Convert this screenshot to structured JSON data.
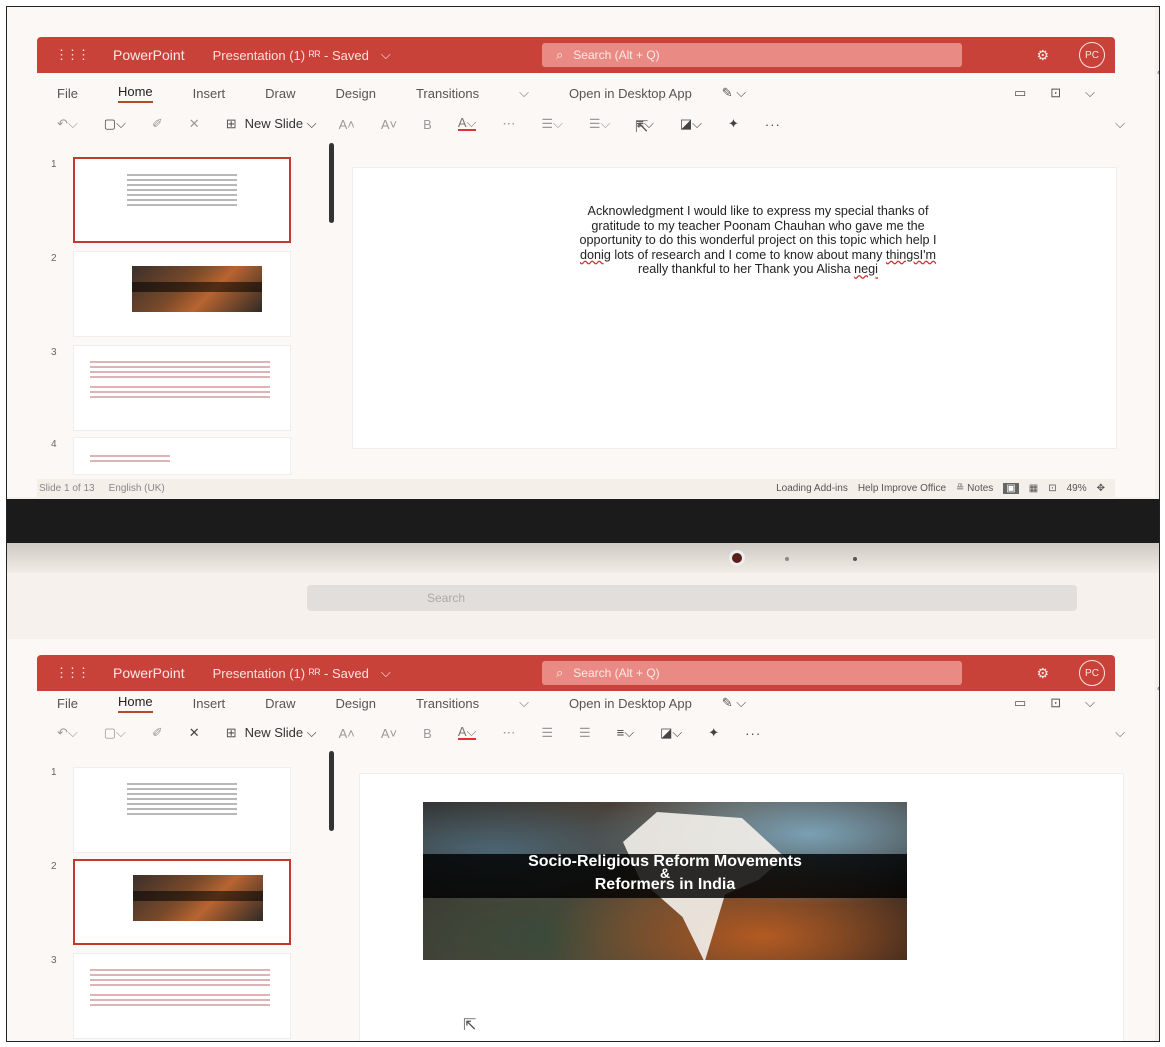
{
  "app": {
    "name": "PowerPoint",
    "doc_title": "Presentation (1) ᴿᴿ - Saved",
    "search_placeholder": "Search (Alt + Q)",
    "user_initials": "PC"
  },
  "tabs": [
    "File",
    "Home",
    "Insert",
    "Draw",
    "Design",
    "Transitions",
    "⌵",
    "Open in Desktop App",
    "✎ ⌵"
  ],
  "toolbar": {
    "new_slide": "New Slide ⌵",
    "more": "···"
  },
  "slides": {
    "numbers": [
      "1",
      "2",
      "3",
      "4"
    ],
    "acknowledgment_parts": {
      "a": "Acknowledgment I would like to express my special thanks of gratitude to my teacher Poonam Chauhan who gave me the opportunity to do this wonderful project on this topic which help I ",
      "b": "donig",
      "c": " lots of research and I come to know about many ",
      "d": "thingsI'm",
      "e": " really thankful to her Thank you Alisha ",
      "f": "negi"
    },
    "title_slide_line1": "Socio-Religious Reform Movements",
    "title_slide_amp": "&",
    "title_slide_line2": "Reformers in India"
  },
  "statusbar": {
    "slide_count": "Slide 1 of 13",
    "language": "English (UK)",
    "loading": "Loading Add-ins",
    "help": "Help Improve Office",
    "notes": "≞ Notes",
    "zoom": "49%"
  },
  "browser": {
    "search_label": "Search"
  },
  "colors": {
    "titlebar": "#c9423a",
    "accent": "#b7472a"
  }
}
